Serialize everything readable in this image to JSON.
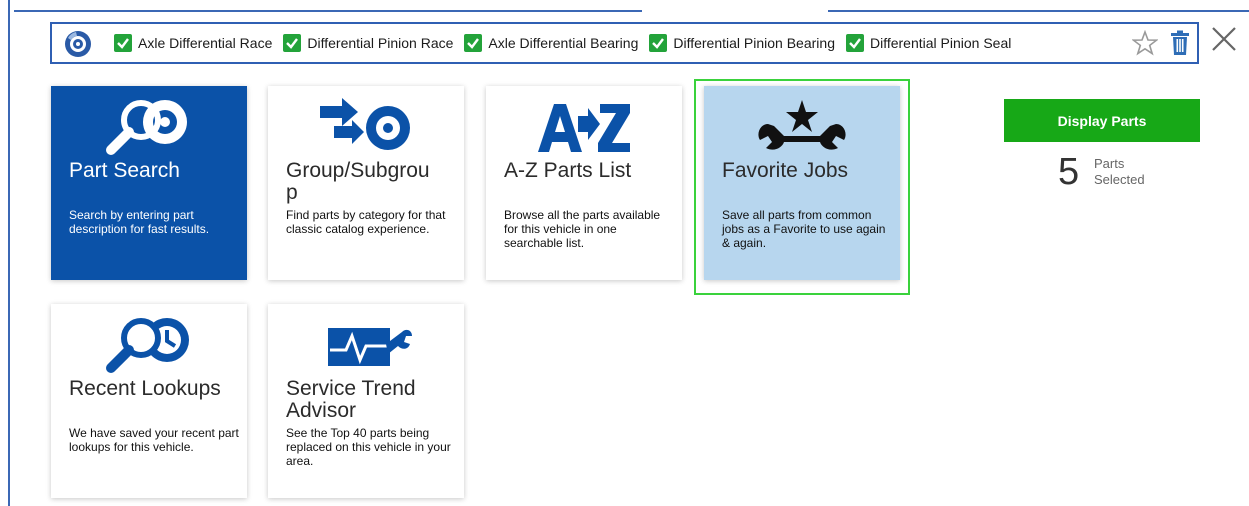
{
  "selection_bar": {
    "chips": [
      {
        "label": "Axle Differential Race",
        "checked": true
      },
      {
        "label": "Differential Pinion Race",
        "checked": true
      },
      {
        "label": "Axle Differential Bearing",
        "checked": true
      },
      {
        "label": "Differential Pinion Bearing",
        "checked": true
      },
      {
        "label": "Differential Pinion Seal",
        "checked": true
      }
    ],
    "icons": [
      "brake-rotor-logo-icon",
      "star-icon",
      "trash-icon",
      "close-icon"
    ]
  },
  "cards": {
    "part_search": {
      "title": "Part Search",
      "desc": "Search by entering part description for fast results.",
      "icon": "magnifier-rotor-icon"
    },
    "group_subgroup": {
      "title": "Group/Subgrou\np",
      "desc": "Find parts by category for that classic catalog experience.",
      "icon": "arrow-rotor-icon"
    },
    "az_parts": {
      "title": "A-Z Parts List",
      "desc": "Browse all the parts available for this vehicle in one searchable list.",
      "icon": "a-to-z-icon"
    },
    "favorite_jobs": {
      "title": "Favorite Jobs",
      "desc": "Save all parts from common jobs as a Favorite to use again & again.",
      "icon": "wrench-star-icon"
    },
    "recent_lookups": {
      "title": "Recent Lookups",
      "desc": "We have saved your recent part lookups for this vehicle.",
      "icon": "magnifier-clock-icon"
    },
    "service_trend": {
      "title": "Service Trend\nAdvisor",
      "desc": "See the Top 40 parts being replaced on this vehicle in your area.",
      "icon": "pulse-wrench-icon"
    }
  },
  "actions": {
    "display_parts_label": "Display Parts",
    "parts_count": "5",
    "parts_selected_label": "Parts\nSelected"
  },
  "colors": {
    "brand_blue": "#0b52a8",
    "accent_green": "#17a817",
    "selected_card_bg": "#b7d6ee",
    "selected_outline": "#3ad23c"
  }
}
